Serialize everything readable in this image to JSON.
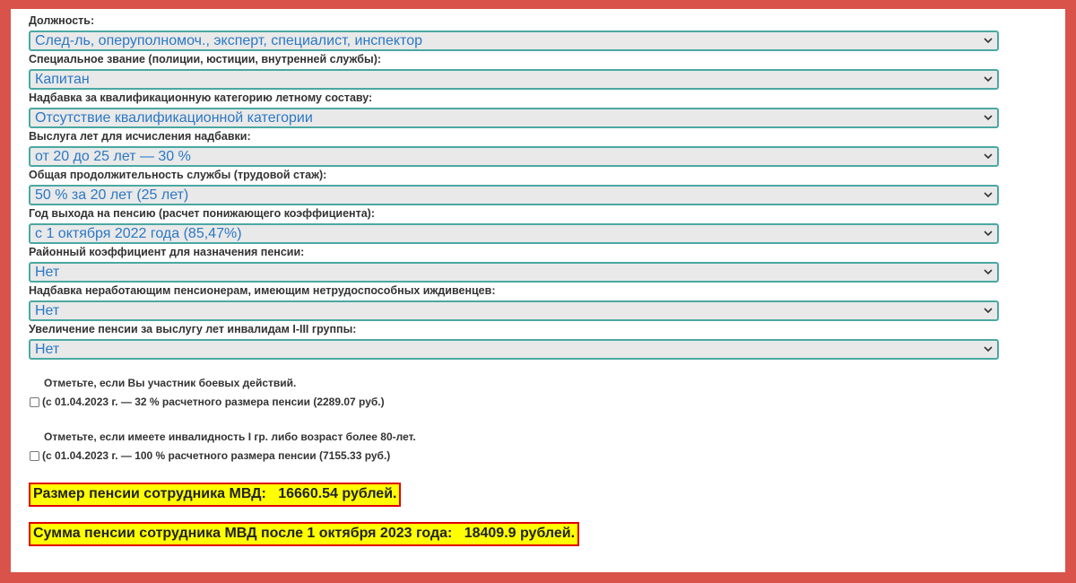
{
  "form": {
    "fields": [
      {
        "label": "Должность:",
        "value": "След-ль, оперуполномоч., эксперт, специалист, инспектор"
      },
      {
        "label": "Специальное звание (полиции, юстиции, внутренней службы):",
        "value": "Капитан"
      },
      {
        "label": "Надбавка за квалификационную категорию летному составу:",
        "value": "Отсутствие квалификационной категории"
      },
      {
        "label": "Выслуга лет для исчисления надбавки:",
        "value": "от 20 до 25 лет — 30 %"
      },
      {
        "label": "Общая продолжительность службы (трудовой стаж):",
        "value": "50 % за 20 лет (25 лет)"
      },
      {
        "label": "Год выхода на пенсию (расчет понижающего коэффициента):",
        "value": "с 1 октября 2022 года (85,47%)"
      },
      {
        "label": "Районный коэффициент для назначения пенсии:",
        "value": "Нет"
      },
      {
        "label": "Надбавка неработающим пенсионерам, имеющим нетрудоспособных иждивенцев:",
        "value": "Нет"
      },
      {
        "label": "Увеличение пенсии за выслугу лет инвалидам I-III группы:",
        "value": "Нет"
      }
    ],
    "checkboxes": [
      {
        "title": "Отметьте, если Вы участник боевых действий.",
        "text": "(с 01.04.2023 г. — 32 % расчетного размера пенсии (2289.07 руб.)",
        "checked": false
      },
      {
        "title": "Отметьте, если имеете инвалидность I гр. либо возраст более 80-лет.",
        "text": "(с 01.04.2023 г. — 100 % расчетного размера пенсии (7155.33 руб.)",
        "checked": false
      }
    ]
  },
  "results": {
    "pension": "Размер пенсии сотрудника МВД:   16660.54 рублей.",
    "pension_after": "Сумма пенсии сотрудника МВД после 1 октября 2023 года:   18409.9 рублей."
  },
  "colors": {
    "frame": "#d9534a",
    "select_border": "#4aa8a2",
    "select_text": "#2b78c5",
    "result_bg": "#ffff00",
    "result_border": "#e00000"
  },
  "icons": {
    "select_arrow": "chevron-down-icon"
  }
}
